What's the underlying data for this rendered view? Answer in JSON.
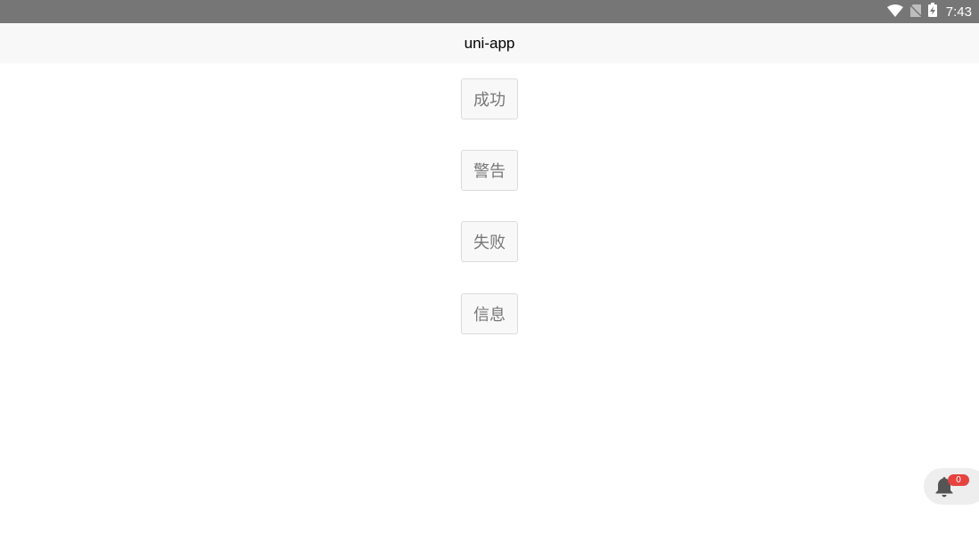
{
  "status_bar": {
    "time": "7:43",
    "icons": [
      "wifi-icon",
      "no-sim-icon",
      "battery-charging-icon"
    ]
  },
  "nav_bar": {
    "title": "uni-app"
  },
  "buttons": [
    {
      "label": "成功"
    },
    {
      "label": "警告"
    },
    {
      "label": "失败"
    },
    {
      "label": "信息"
    }
  ],
  "notification": {
    "icon": "bell-icon",
    "count": "0",
    "badge_color": "#e64340"
  }
}
